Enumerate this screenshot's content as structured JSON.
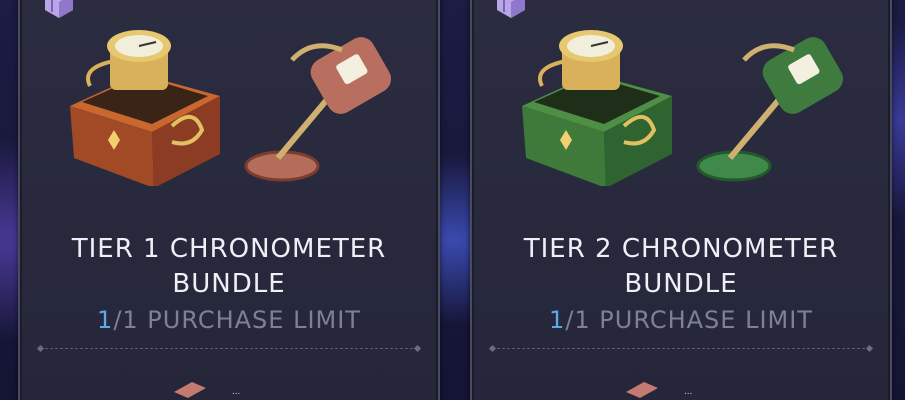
{
  "cards": [
    {
      "title_line1": "TIER 1 CHRONOMETER",
      "title_line2": "BUNDLE",
      "limit_count": "1",
      "limit_rest": "/1 PURCHASE LIMIT",
      "accent_color": "#b04e2e",
      "cost_label": "..."
    },
    {
      "title_line1": "TIER 2 CHRONOMETER",
      "title_line2": "BUNDLE",
      "limit_count": "1",
      "limit_rest": "/1 PURCHASE LIMIT",
      "accent_color": "#3f7a3a",
      "cost_label": "..."
    }
  ],
  "icons": {
    "corner": "bundle-cube-icon",
    "box": "chronometer-box-icon",
    "detector": "metal-detector-icon",
    "cost": "currency-icon"
  }
}
